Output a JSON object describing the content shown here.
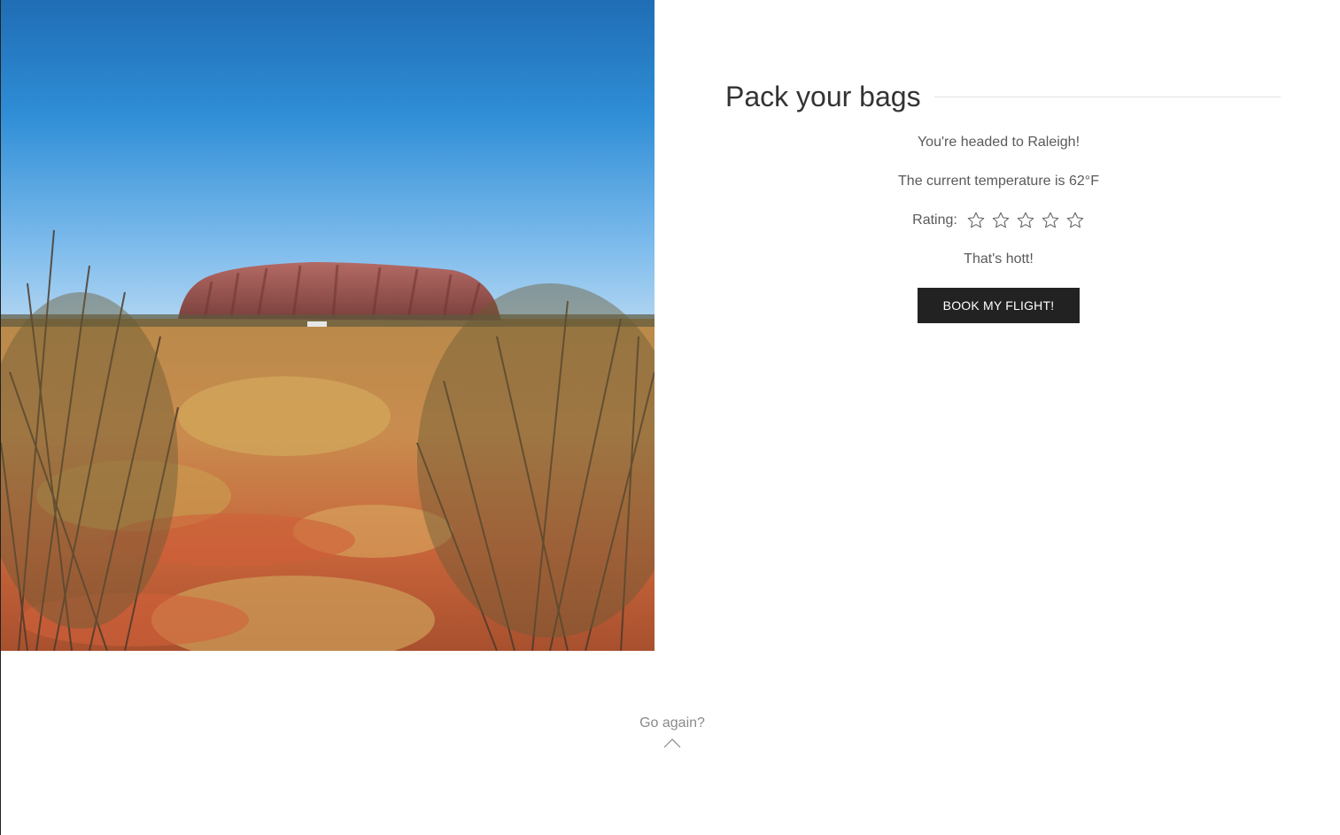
{
  "hero": {
    "image_icon": "desert-rock-landscape-photo"
  },
  "card": {
    "title": "Pack your bags",
    "destination_text": "You're headed to Raleigh!",
    "temperature_text": "The current temperature is 62°F",
    "rating_label": "Rating:",
    "rating": {
      "value": 0,
      "max": 5,
      "star_icon": "star-outline-icon"
    },
    "heat_comment": "That's hott!",
    "book_button_label": "BOOK MY FLIGHT!"
  },
  "footer": {
    "go_again_label": "Go again?",
    "go_again_icon": "chevron-up-icon"
  },
  "colors": {
    "button_bg": "#222222",
    "button_text": "#ffffff",
    "title_text": "#333333",
    "body_text": "#5a5a5a",
    "muted_text": "#8a8a8a"
  }
}
